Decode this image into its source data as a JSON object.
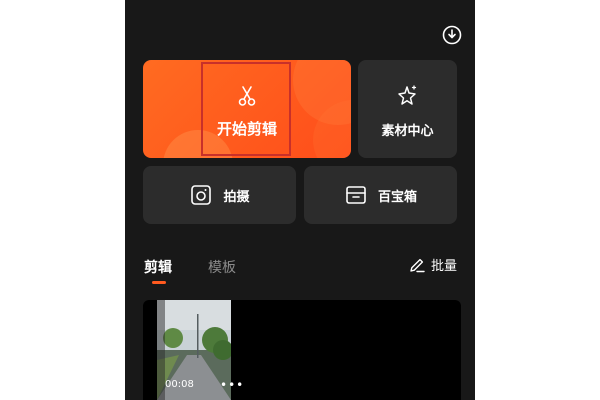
{
  "main_cards": {
    "start_edit_label": "开始剪辑",
    "material_center_label": "素材中心",
    "shoot_label": "拍摄",
    "toolbox_label": "百宝箱"
  },
  "tabs": [
    {
      "label": "剪辑",
      "active": true
    },
    {
      "label": "模板",
      "active": false
    }
  ],
  "batch_label": "批量",
  "projects": [
    {
      "duration": "00:08"
    }
  ],
  "colors": {
    "accent": "#ff5a1f",
    "background": "#181818",
    "card": "#2c2c2c"
  },
  "icons": {
    "download": "download-icon",
    "scissors": "scissors-icon",
    "sparkle": "sparkle-icon",
    "camera": "camera-icon",
    "toolbox": "toolbox-icon",
    "pen": "pen-icon",
    "more": "more-dots-icon"
  }
}
